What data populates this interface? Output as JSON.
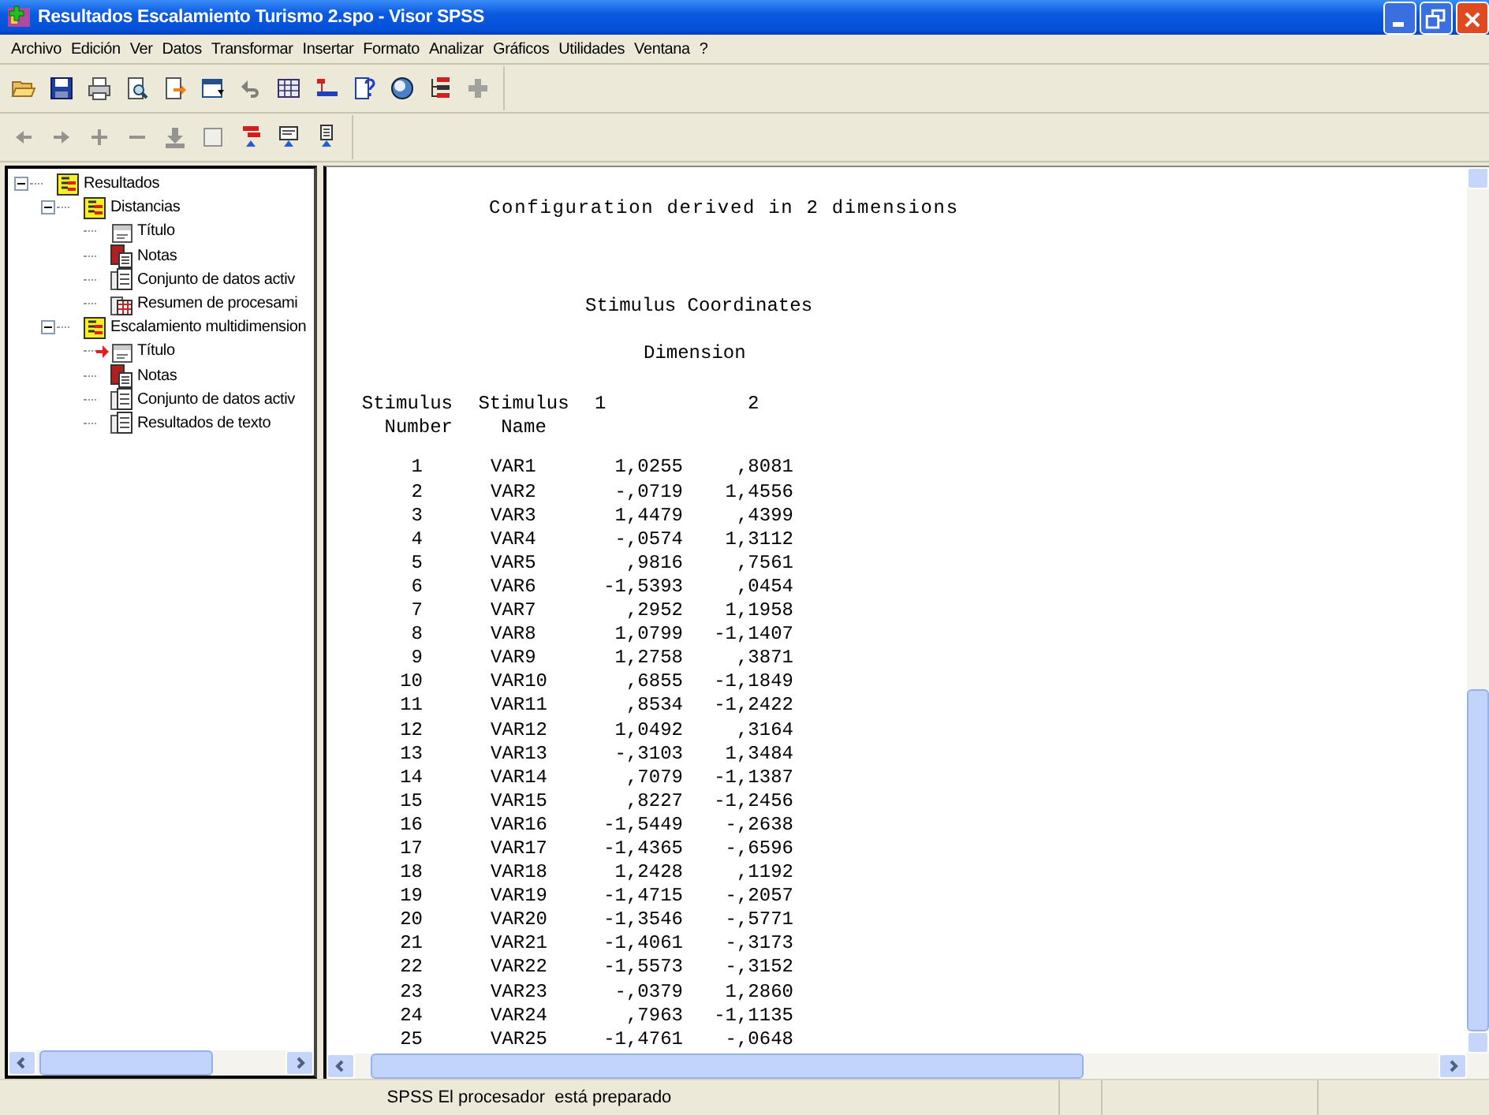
{
  "window": {
    "title": "Resultados Escalamiento Turismo 2.spo - Visor SPSS"
  },
  "menu": [
    "Archivo",
    "Edición",
    "Ver",
    "Datos",
    "Transformar",
    "Insertar",
    "Formato",
    "Analizar",
    "Gráficos",
    "Utilidades",
    "Ventana",
    "?"
  ],
  "toolbar_1": [
    {
      "kind": "open",
      "disabled": false
    },
    {
      "kind": "save",
      "disabled": false
    },
    {
      "kind": "print",
      "disabled": false
    },
    {
      "kind": "preview",
      "disabled": false
    },
    {
      "kind": "export",
      "disabled": false
    },
    {
      "kind": "recall",
      "disabled": false
    },
    {
      "kind": "undo",
      "disabled": true
    },
    {
      "kind": "data",
      "disabled": false
    },
    {
      "kind": "case",
      "disabled": false
    },
    {
      "kind": "variables",
      "disabled": false
    },
    {
      "kind": "sets",
      "disabled": false
    },
    {
      "kind": "designate",
      "disabled": false
    },
    {
      "kind": "plus",
      "disabled": true
    }
  ],
  "toolbar_2": [
    {
      "kind": "back",
      "disabled": true
    },
    {
      "kind": "forward",
      "disabled": true
    },
    {
      "kind": "plus",
      "disabled": true
    },
    {
      "kind": "minus",
      "disabled": true
    },
    {
      "kind": "show",
      "disabled": true
    },
    {
      "kind": "hide",
      "disabled": true
    },
    {
      "kind": "heading",
      "disabled": false
    },
    {
      "kind": "title",
      "disabled": false
    },
    {
      "kind": "text",
      "disabled": false
    }
  ],
  "tree": [
    {
      "label": "Resultados",
      "kind": "folder",
      "expanded": true,
      "children": [
        {
          "label": "Distancias",
          "kind": "folder",
          "expanded": true,
          "children": [
            {
              "label": "Título",
              "kind": "title",
              "current": false
            },
            {
              "label": "Notas",
              "kind": "notes",
              "current": false
            },
            {
              "label": "Conjunto de datos activ",
              "kind": "text",
              "current": false
            },
            {
              "label": "Resumen de procesami",
              "kind": "table",
              "current": false
            }
          ]
        },
        {
          "label": "Escalamiento multidimension",
          "kind": "folder",
          "expanded": true,
          "children": [
            {
              "label": "Título",
              "kind": "title",
              "current": true
            },
            {
              "label": "Notas",
              "kind": "notes",
              "current": false
            },
            {
              "label": "Conjunto de datos activ",
              "kind": "text",
              "current": false
            },
            {
              "label": "Resultados de texto",
              "kind": "text",
              "current": false
            }
          ]
        }
      ]
    }
  ],
  "output": {
    "heading": "Configuration derived in 2 dimensions",
    "table_title": "Stimulus Coordinates",
    "group_label": "Dimension",
    "columns": [
      {
        "lines": [
          "Stimulus",
          "Number"
        ]
      },
      {
        "lines": [
          "Stimulus",
          "Name"
        ]
      },
      {
        "lines": [
          "1"
        ]
      },
      {
        "lines": [
          "2"
        ]
      }
    ],
    "rows": [
      [
        "1",
        "VAR1",
        "1,0255",
        ",8081"
      ],
      [
        "2",
        "VAR2",
        "-,0719",
        "1,4556"
      ],
      [
        "3",
        "VAR3",
        "1,4479",
        ",4399"
      ],
      [
        "4",
        "VAR4",
        "-,0574",
        "1,3112"
      ],
      [
        "5",
        "VAR5",
        ",9816",
        ",7561"
      ],
      [
        "6",
        "VAR6",
        "-1,5393",
        ",0454"
      ],
      [
        "7",
        "VAR7",
        ",2952",
        "1,1958"
      ],
      [
        "8",
        "VAR8",
        "1,0799",
        "-1,1407"
      ],
      [
        "9",
        "VAR9",
        "1,2758",
        ",3871"
      ],
      [
        "10",
        "VAR10",
        ",6855",
        "-1,1849"
      ],
      [
        "11",
        "VAR11",
        ",8534",
        "-1,2422"
      ],
      [
        "12",
        "VAR12",
        "1,0492",
        ",3164"
      ],
      [
        "13",
        "VAR13",
        "-,3103",
        "1,3484"
      ],
      [
        "14",
        "VAR14",
        ",7079",
        "-1,1387"
      ],
      [
        "15",
        "VAR15",
        ",8227",
        "-1,2456"
      ],
      [
        "16",
        "VAR16",
        "-1,5449",
        "-,2638"
      ],
      [
        "17",
        "VAR17",
        "-1,4365",
        "-,6596"
      ],
      [
        "18",
        "VAR18",
        "1,2428",
        ",1192"
      ],
      [
        "19",
        "VAR19",
        "-1,4715",
        "-,2057"
      ],
      [
        "20",
        "VAR20",
        "-1,3546",
        "-,5771"
      ],
      [
        "21",
        "VAR21",
        "-1,4061",
        "-,3173"
      ],
      [
        "22",
        "VAR22",
        "-1,5573",
        "-,3152"
      ],
      [
        "23",
        "VAR23",
        "-,0379",
        "1,2860"
      ],
      [
        "24",
        "VAR24",
        ",7963",
        "-1,1135"
      ],
      [
        "25",
        "VAR25",
        "-1,4761",
        "-,0648"
      ]
    ]
  },
  "status_bar": {
    "message": "SPSS El procesador  está preparado"
  }
}
